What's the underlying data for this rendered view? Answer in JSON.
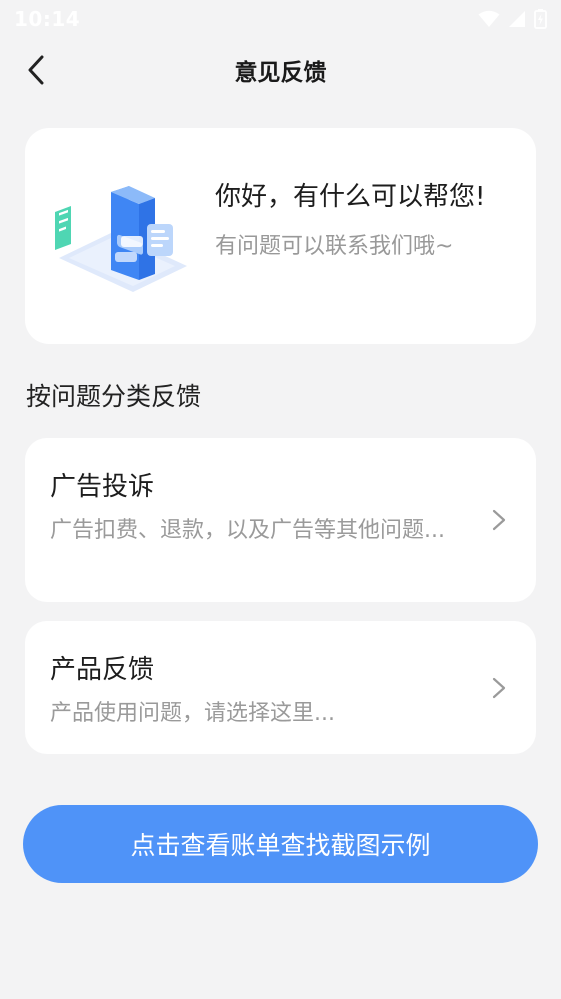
{
  "status_bar": {
    "time": "10:14"
  },
  "nav": {
    "title": "意见反馈"
  },
  "hero": {
    "title": "你好，有什么可以帮您!",
    "subtitle": "有问题可以联系我们哦~"
  },
  "section": {
    "title": "按问题分类反馈"
  },
  "categories": [
    {
      "title": "广告投诉",
      "description": "广告扣费、退款，以及广告等其他问题..."
    },
    {
      "title": "产品反馈",
      "description": "产品使用问题，请选择这里..."
    }
  ],
  "action_button": {
    "label": "点击查看账单查找截图示例"
  },
  "colors": {
    "background": "#f3f3f4",
    "card": "#ffffff",
    "accent": "#4f93f8",
    "secondary_text": "#9a9a9a"
  },
  "icons": [
    "wifi-icon",
    "signal-icon",
    "battery-icon",
    "back-arrow-icon",
    "chevron-right-icon",
    "chat-illustration"
  ]
}
